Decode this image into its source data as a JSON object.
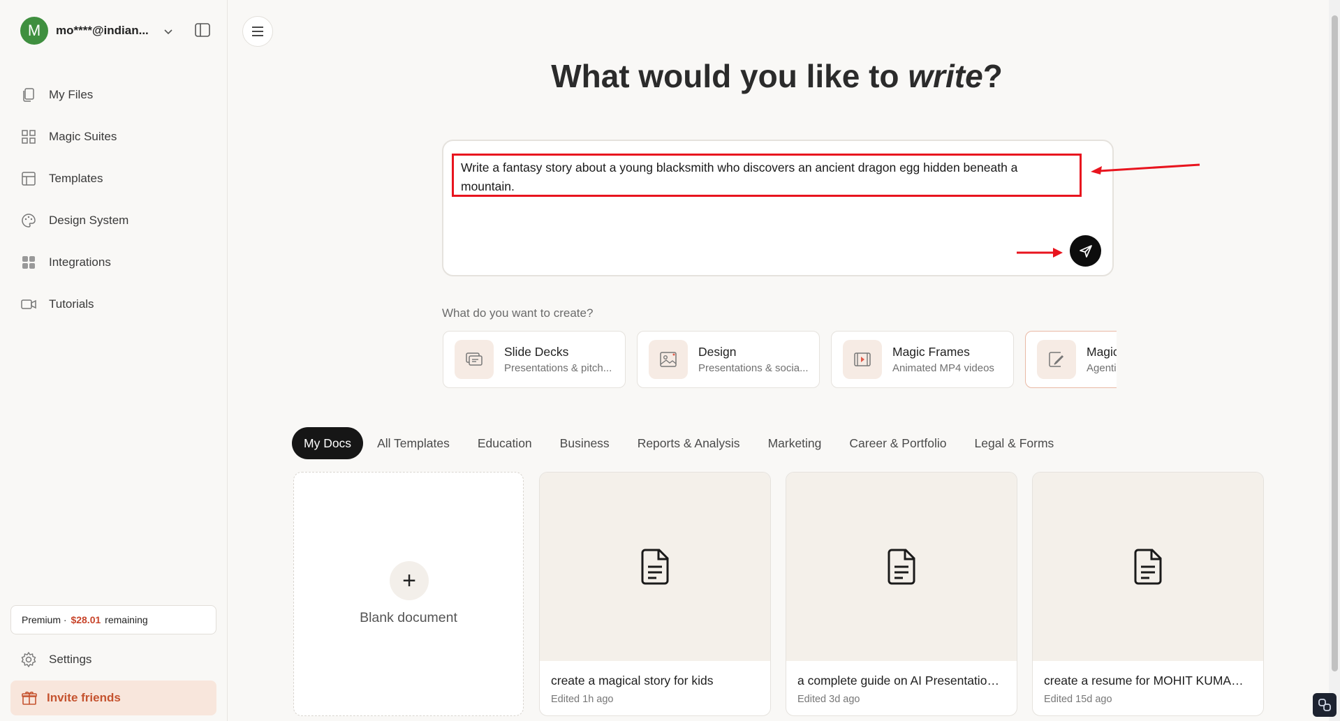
{
  "account": {
    "avatar_letter": "M",
    "email": "mo****@indian..."
  },
  "sidebar": {
    "items": [
      {
        "label": "My Files",
        "icon": "files-icon"
      },
      {
        "label": "Magic Suites",
        "icon": "grid-icon"
      },
      {
        "label": "Templates",
        "icon": "layout-icon"
      },
      {
        "label": "Design System",
        "icon": "palette-icon"
      },
      {
        "label": "Integrations",
        "icon": "apps-icon"
      },
      {
        "label": "Tutorials",
        "icon": "video-icon"
      }
    ],
    "premium_prefix": "Premium · ",
    "premium_amount": "$28.01",
    "premium_suffix": " remaining",
    "settings_label": "Settings",
    "invite_label": "Invite friends"
  },
  "main": {
    "headline_pre": "What would you like to ",
    "headline_em": "write",
    "headline_post": "?",
    "prompt_value": "Write a fantasy story about a young blacksmith who discovers an ancient dragon egg hidden beneath a mountain.",
    "create_label": "What do you want to create?",
    "create_cards": [
      {
        "title": "Slide Decks",
        "subtitle": "Presentations & pitch..."
      },
      {
        "title": "Design",
        "subtitle": "Presentations & socia..."
      },
      {
        "title": "Magic Frames",
        "subtitle": "Animated MP4 videos"
      },
      {
        "title": "Magic",
        "subtitle": "Agenti"
      }
    ],
    "tabs": [
      "My Docs",
      "All Templates",
      "Education",
      "Business",
      "Reports & Analysis",
      "Marketing",
      "Career & Portfolio",
      "Legal & Forms"
    ],
    "blank_label": "Blank document",
    "docs": [
      {
        "title": "create a magical story for kids",
        "meta": "Edited 1h ago"
      },
      {
        "title": "a complete guide on AI Presentation ...",
        "meta": "Edited 3d ago"
      },
      {
        "title": "create a resume for MOHIT KUMAR J...",
        "meta": "Edited 15d ago"
      }
    ]
  },
  "colors": {
    "accent": "#c5532f",
    "annotation": "#e8141e",
    "avatar": "#3f8f3f"
  }
}
